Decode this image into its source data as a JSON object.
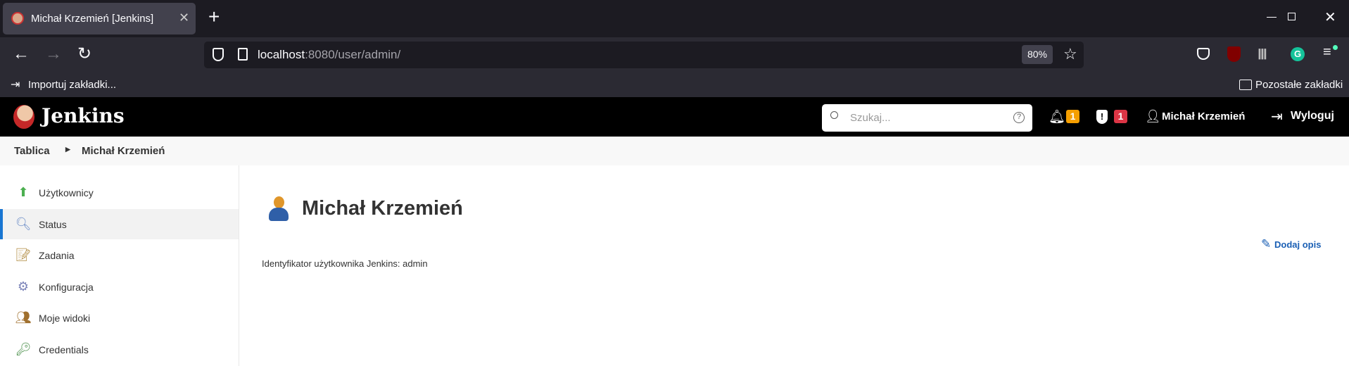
{
  "browser": {
    "tab_title": "Michał Krzemień [Jenkins]",
    "url_host": "localhost",
    "url_rest": ":8080/user/admin/",
    "zoom": "80%",
    "bookmark_import": "Importuj zakładki...",
    "other_bookmarks": "Pozostałe zakładki"
  },
  "header": {
    "brand": "Jenkins",
    "search_placeholder": "Szukaj...",
    "notifications_count": "1",
    "security_count": "1",
    "user_name": "Michał Krzemień",
    "logout": "Wyloguj",
    "colors": {
      "notif": "#f59f00",
      "security": "#dc3545"
    }
  },
  "breadcrumb": {
    "items": [
      "Tablica",
      "Michał Krzemień"
    ]
  },
  "sidebar": {
    "items": [
      {
        "label": "Użytkownicy",
        "icon": "up-arrow-icon"
      },
      {
        "label": "Status",
        "icon": "magnifier-icon",
        "active": true
      },
      {
        "label": "Zadania",
        "icon": "notepad-icon"
      },
      {
        "label": "Konfiguracja",
        "icon": "gear-icon"
      },
      {
        "label": "Moje widoki",
        "icon": "users-icon"
      },
      {
        "label": "Credentials",
        "icon": "keys-icon"
      }
    ]
  },
  "main": {
    "title": "Michał Krzemień",
    "user_id_text": "Identyfikator użytkownika Jenkins: admin",
    "add_description": "Dodaj opis"
  }
}
